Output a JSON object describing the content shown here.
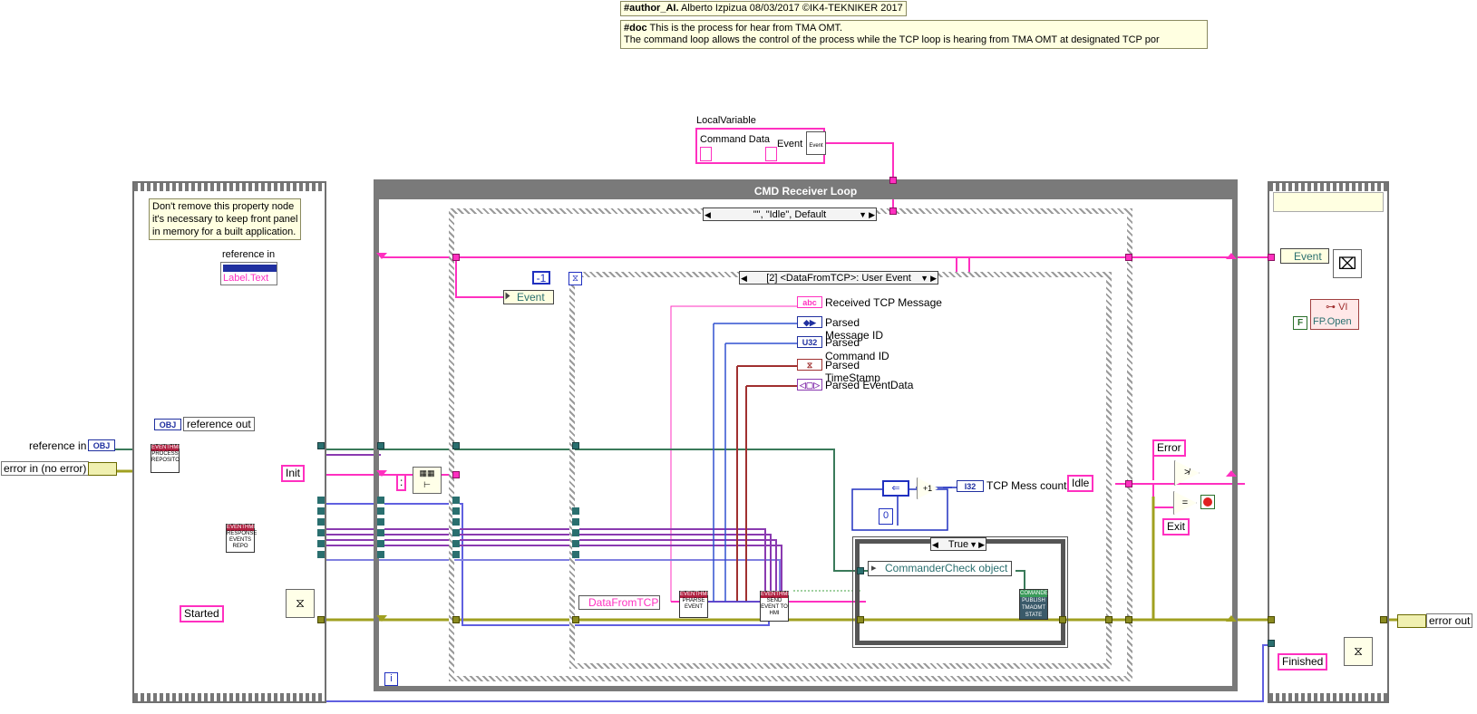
{
  "notes": {
    "author_tag": "#author_AI.",
    "author_text": " Alberto Izpizua 08/03/2017 ©IK4-TEKNIKER 2017",
    "doc_tag": "#doc",
    "doc_line1": " This is the process for hear from TMA OMT.",
    "doc_line2": "The command loop allows the control of the process while the TCP loop is hearing from TMA OMT at designated TCP por",
    "property_line1": "Don't remove this property node",
    "property_line2": "it's necessary to keep front panel",
    "property_line3": "in memory for a built application."
  },
  "left_frame": {
    "reference_in_label": "reference in",
    "label_text": "Label.Text",
    "reference_out": "reference out",
    "obj_tag": "OBJ",
    "init": "Init",
    "started": "Started"
  },
  "terminals": {
    "reference_in": "reference in",
    "error_in": "error in (no error)",
    "error_out": "error out"
  },
  "local_variable": {
    "caption": "LocalVariable",
    "command_data": "Command Data",
    "event": "Event",
    "event_icon": "Event"
  },
  "loop": {
    "title": "CMD Receiver Loop",
    "iteration": "i"
  },
  "outer_case": {
    "selector": "\"\", \"Idle\", Default"
  },
  "event_structure": {
    "selector": "[2] <DataFromTCP>: User Event",
    "timeout": "-1",
    "event_node": "Event",
    "data_node": "DataFromTCP"
  },
  "event_data": {
    "received": "Received TCP Message",
    "parsed1": "Parsed",
    "message_id": "Message ID",
    "parsed2": "Parsed",
    "command_id": "Command ID",
    "parsed3": "Parsed",
    "timestamp": "TimeStamp",
    "parsed_eventdata": "Parsed EventData",
    "abc_tag": "abc",
    "u32_tag": "U32"
  },
  "counter": {
    "label": "TCP Mess counte",
    "zero": "0",
    "plus_one": "+1",
    "i32_tag": "I32"
  },
  "inner_case": {
    "selector": "True",
    "commander": "CommanderCheck object",
    "publish_line1": "COMANDE",
    "publish_line2": "PUBLISH",
    "publish_line3": "TMAOMT",
    "publish_line4": "STATE"
  },
  "subvis": {
    "process_hd": "EVENTHMI",
    "process_line1": "PROCESS",
    "process_line2": "REPOSITO",
    "response_hd": "EVENTHMI",
    "response_line1": "RESPONSE",
    "response_line2": "EVENTS",
    "response_line3": "REPO",
    "parse_hd": "EVENTHMI",
    "parse_line1": "PHARSE",
    "parse_line2": "EVENT",
    "send_hd": "EVENTHMI",
    "send_line1": "SEND",
    "send_line2": "EVENT TO",
    "send_line3": "HMI"
  },
  "right_area": {
    "idle": "Idle",
    "error": "Error",
    "exit": "Exit"
  },
  "right_frame": {
    "event": "Event",
    "vi": "VI",
    "fp_open": "FP.Open",
    "false_const": "F",
    "finished": "Finished"
  }
}
